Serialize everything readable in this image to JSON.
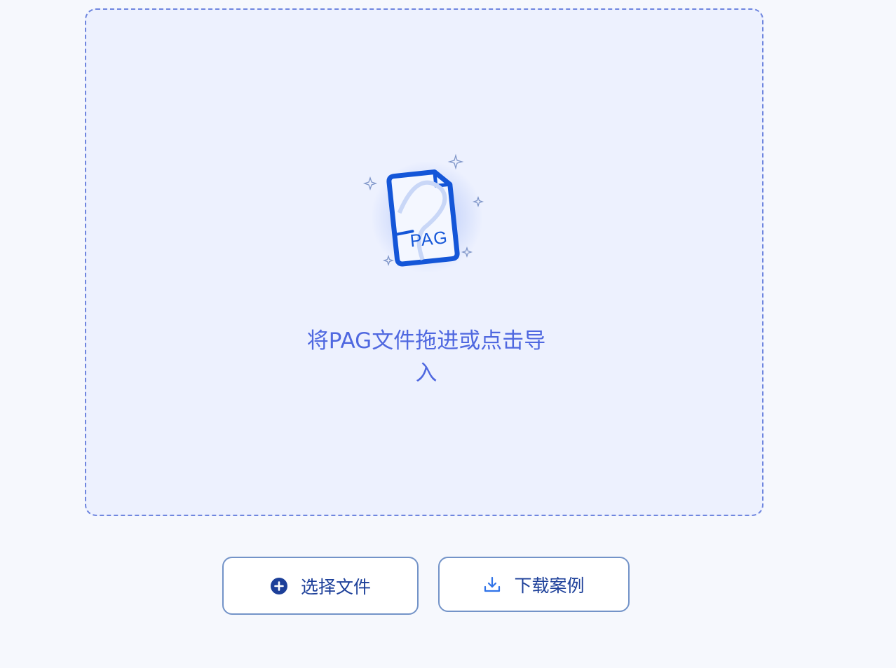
{
  "drop_zone": {
    "hint_line1": "将PAG文件拖进或点击导",
    "hint_line2": "入",
    "illustration_label": "PAG"
  },
  "actions": {
    "select_file_label": "选择文件",
    "select_file_icon": "plus-circle-icon",
    "download_example_label": "下载案例",
    "download_example_icon": "download-icon"
  },
  "colors": {
    "accent": "#4f68e0",
    "button_text": "#1c3f99",
    "border": "#6f86df",
    "file_icon": "#1456d8"
  }
}
